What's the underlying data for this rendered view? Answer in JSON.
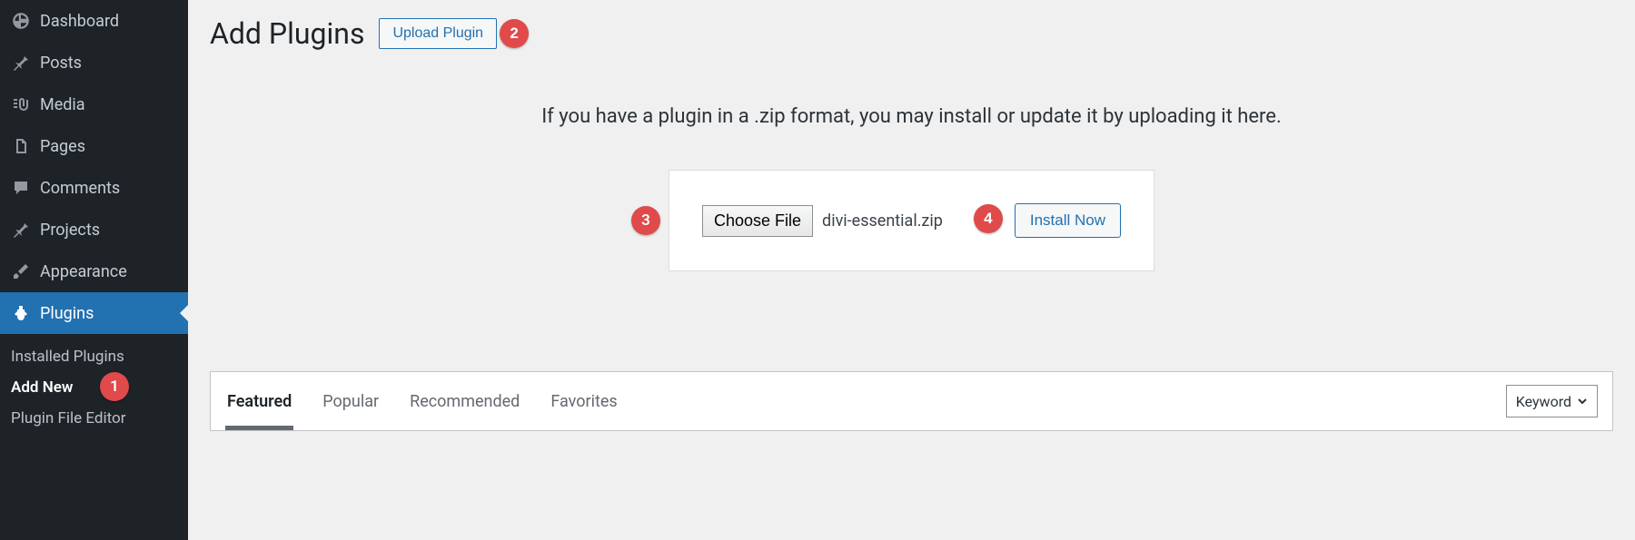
{
  "sidebar": {
    "items": [
      {
        "label": "Dashboard",
        "icon": "dashboard"
      },
      {
        "label": "Posts",
        "icon": "pin"
      },
      {
        "label": "Media",
        "icon": "media"
      },
      {
        "label": "Pages",
        "icon": "pages"
      },
      {
        "label": "Comments",
        "icon": "comments"
      },
      {
        "label": "Projects",
        "icon": "pin"
      },
      {
        "label": "Appearance",
        "icon": "brush"
      },
      {
        "label": "Plugins",
        "icon": "plug"
      }
    ],
    "submenu": [
      {
        "label": "Installed Plugins"
      },
      {
        "label": "Add New",
        "current": true
      },
      {
        "label": "Plugin File Editor"
      }
    ]
  },
  "header": {
    "title": "Add Plugins",
    "upload_button": "Upload Plugin"
  },
  "upload_panel": {
    "help": "If you have a plugin in a .zip format, you may install or update it by uploading it here.",
    "choose_file_label": "Choose File",
    "selected_file": "divi-essential.zip",
    "install_button": "Install Now"
  },
  "filter": {
    "tabs": [
      "Featured",
      "Popular",
      "Recommended",
      "Favorites"
    ],
    "active_tab": 0,
    "search_mode": "Keyword"
  },
  "callouts": {
    "c1": "1",
    "c2": "2",
    "c3": "3",
    "c4": "4"
  }
}
